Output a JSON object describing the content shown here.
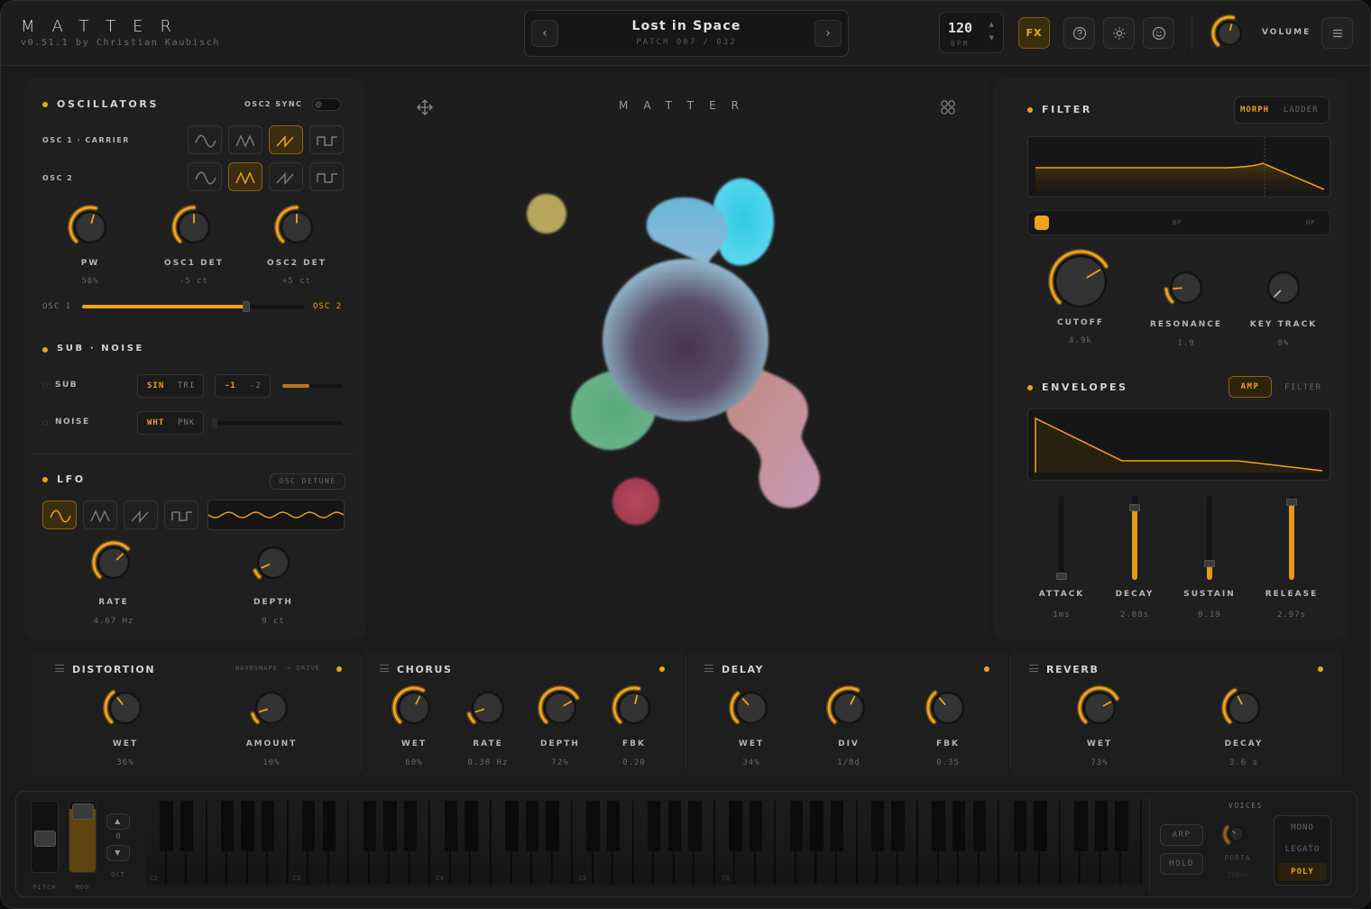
{
  "app": {
    "logo": "MATTER",
    "version": "v0.51.1  by Christian Kaubisch"
  },
  "header": {
    "patch_name": "Lost in Space",
    "patch_number": "PATCH 007 / 032",
    "bpm_value": "120",
    "bpm_label": "BPM",
    "fx_label": "FX",
    "volume_label": "VOLUME",
    "prev_icon": "‹",
    "next_icon": "›",
    "volume_level": 0.55
  },
  "oscillators": {
    "title": "OSCILLATORS",
    "sync_label": "OSC2 SYNC",
    "osc1_label": "OSC 1 · CARRIER",
    "osc2_label": "OSC 2",
    "osc1_selected": "saw",
    "osc2_selected": "triangle",
    "knobs": [
      {
        "label": "PW",
        "value": "56%",
        "level": 0.56
      },
      {
        "label": "OSC1 DET",
        "value": "-5 ct",
        "level": 0.5
      },
      {
        "label": "OSC2 DET",
        "value": "+5 ct",
        "level": 0.5
      }
    ],
    "mix_left": "OSC 1",
    "mix_right": "OSC 2",
    "mix_level": 0.74
  },
  "sub_noise": {
    "title": "SUB · NOISE",
    "sub_label": "SUB",
    "noise_label": "NOISE",
    "sub_wave": [
      "SIN",
      "TRI"
    ],
    "sub_oct": [
      "-1",
      "-2"
    ],
    "noise_type": [
      "WHT",
      "PNK"
    ],
    "sub_level": 0.45,
    "noise_level": 0.0
  },
  "lfo": {
    "title": "LFO",
    "target": "OSC DETUNE",
    "selected": "sine",
    "knobs": [
      {
        "label": "RATE",
        "value": "4.67 Hz",
        "level": 0.67
      },
      {
        "label": "DEPTH",
        "value": "9 ct",
        "level": 0.08
      }
    ]
  },
  "center": {
    "title": "MATTER"
  },
  "filter": {
    "title": "FILTER",
    "modes": [
      "MORPH",
      "LADDER"
    ],
    "morph_labels": [
      "BP",
      "HP"
    ],
    "knobs": [
      {
        "label": "CUTOFF",
        "value": "4.9k",
        "level": 0.72
      },
      {
        "label": "RESONANCE",
        "value": "1.9",
        "level": 0.15
      },
      {
        "label": "KEY TRACK",
        "value": "0%",
        "level": 0.0
      }
    ]
  },
  "envelopes": {
    "title": "ENVELOPES",
    "tabs": [
      "AMP",
      "FILTER"
    ],
    "sliders": [
      {
        "label": "ATTACK",
        "value": "1ms",
        "level": 0.0
      },
      {
        "label": "DECAY",
        "value": "2.08s",
        "level": 0.85
      },
      {
        "label": "SUSTAIN",
        "value": "0.19",
        "level": 0.19
      },
      {
        "label": "RELEASE",
        "value": "2.97s",
        "level": 0.92
      }
    ]
  },
  "effects": [
    {
      "title": "DISTORTION",
      "subtitle": "WAVESHAPE -> DRIVE",
      "knobs": [
        {
          "label": "WET",
          "value": "36%",
          "level": 0.36
        },
        {
          "label": "AMOUNT",
          "value": "10%",
          "level": 0.1
        }
      ]
    },
    {
      "title": "CHORUS",
      "subtitle": "",
      "knobs": [
        {
          "label": "WET",
          "value": "60%",
          "level": 0.6
        },
        {
          "label": "RATE",
          "value": "0.30 Hz",
          "level": 0.1
        },
        {
          "label": "DEPTH",
          "value": "72%",
          "level": 0.72
        },
        {
          "label": "FBK",
          "value": "0.20",
          "level": 0.55
        }
      ]
    },
    {
      "title": "DELAY",
      "subtitle": "",
      "knobs": [
        {
          "label": "WET",
          "value": "34%",
          "level": 0.34
        },
        {
          "label": "DIV",
          "value": "1/8d",
          "level": 0.6
        },
        {
          "label": "FBK",
          "value": "0.35",
          "level": 0.35
        }
      ]
    },
    {
      "title": "REVERB",
      "subtitle": "",
      "knobs": [
        {
          "label": "WET",
          "value": "73%",
          "level": 0.73
        },
        {
          "label": "DECAY",
          "value": "3.6 s",
          "level": 0.4
        }
      ]
    }
  ],
  "keyboard": {
    "pitch_label": "PITCH",
    "mod_label": "MOD",
    "oct_label": "OCT",
    "oct_value": "0",
    "octave_labels": [
      "C2",
      "C3",
      "C4",
      "C5",
      "C6"
    ],
    "voices_label": "VOICES",
    "arp_label": "ARP",
    "hold_label": "HOLD",
    "porta_label": "PORTA",
    "porta_value": "250ms",
    "voice_modes": [
      "MONO",
      "LEGATO",
      "POLY"
    ],
    "selected_voice": "POLY",
    "mod_level": 0.9
  },
  "colors": {
    "accent": "#f0a21c",
    "bg": "#1b1b1b",
    "panel": "#1f1f1f"
  }
}
